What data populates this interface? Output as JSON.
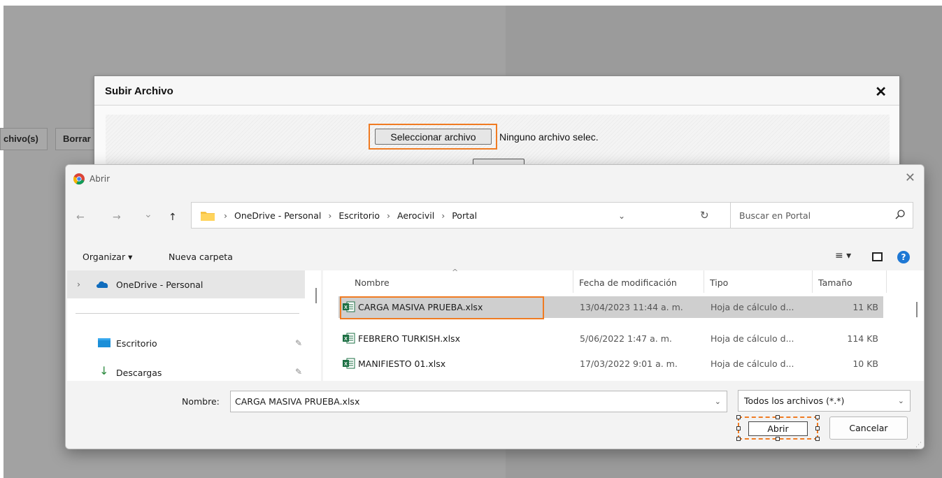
{
  "background": {
    "buttons": [
      "chivo(s)",
      "Borrar"
    ]
  },
  "upload_dialog": {
    "title": "Subir Archivo",
    "close_glyph": "✕",
    "select_label": "Seleccionar archivo",
    "status_text": "Ninguno archivo selec."
  },
  "open_dialog": {
    "title": "Abrir",
    "close_glyph": "✕",
    "nav": {
      "back": "←",
      "forward": "→",
      "recent": "⌄",
      "up": "↑"
    },
    "breadcrumb": [
      "OneDrive - Personal",
      "Escritorio",
      "Aerocivil",
      "Portal"
    ],
    "breadcrumb_separator": "›",
    "search_placeholder": "Buscar en Portal",
    "toolbar": {
      "organize_label": "Organizar ▾",
      "new_folder_label": "Nueva carpeta",
      "view_glyph": "≡ ▾",
      "help_glyph": "?"
    },
    "nav_pane": [
      {
        "label": "OneDrive - Personal",
        "icon": "cloud-icon"
      },
      {
        "label": "Escritorio",
        "icon": "desktop-icon",
        "pinned": true
      },
      {
        "label": "Descargas",
        "icon": "download-icon",
        "pinned": true
      }
    ],
    "columns": [
      "Nombre",
      "Fecha de modificación",
      "Tipo",
      "Tamaño"
    ],
    "files": [
      {
        "name": "CARGA MASIVA PRUEBA.xlsx",
        "date": "13/04/2023 11:44 a. m.",
        "type": "Hoja de cálculo d...",
        "size": "11 KB",
        "selected": true
      },
      {
        "name": "FEBRERO TURKISH.xlsx",
        "date": "5/06/2022 1:47 a. m.",
        "type": "Hoja de cálculo d...",
        "size": "114 KB",
        "selected": false
      },
      {
        "name": "MANIFIESTO 01.xlsx",
        "date": "17/03/2022 9:01 a. m.",
        "type": "Hoja de cálculo d...",
        "size": "10 KB",
        "selected": false
      }
    ],
    "footer": {
      "filename_label": "Nombre:",
      "filename_value": "CARGA MASIVA PRUEBA.xlsx",
      "filetype_value": "Todos los archivos (*.*)",
      "open_label": "Abrir",
      "cancel_label": "Cancelar"
    }
  },
  "colors": {
    "highlight": "#f07b22",
    "selection": "#cfcfcf",
    "excel_green": "#1d7044",
    "onedrive_blue": "#0f6cbd"
  }
}
